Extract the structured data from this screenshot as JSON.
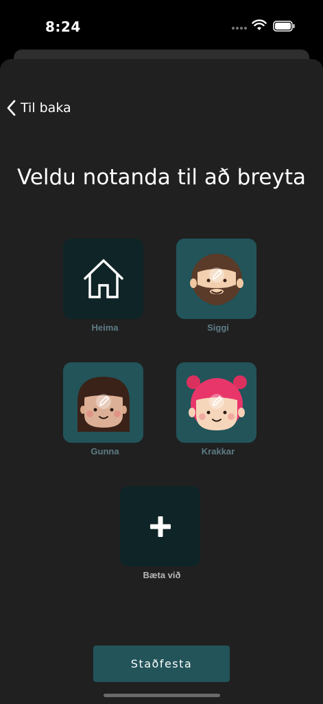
{
  "status_bar": {
    "time": "8:24"
  },
  "nav": {
    "back_label": "Til baka"
  },
  "page": {
    "title": "Veldu notanda til að breyta"
  },
  "profiles": [
    {
      "label": "Heima",
      "icon": "house-icon"
    },
    {
      "label": "Siggi",
      "icon": "bearded-man-avatar"
    },
    {
      "label": "Gunna",
      "icon": "long-hair-woman-avatar"
    },
    {
      "label": "Krakkar",
      "icon": "girl-with-pink-buns-avatar"
    }
  ],
  "add_profile": {
    "label": "Bæta við",
    "icon": "plus-icon"
  },
  "footer": {
    "confirm_label": "Staðfesta"
  },
  "colors": {
    "background": "#202020",
    "tile_dark": "#0f2427",
    "tile_teal": "#22545a",
    "label": "#5d7c84"
  }
}
